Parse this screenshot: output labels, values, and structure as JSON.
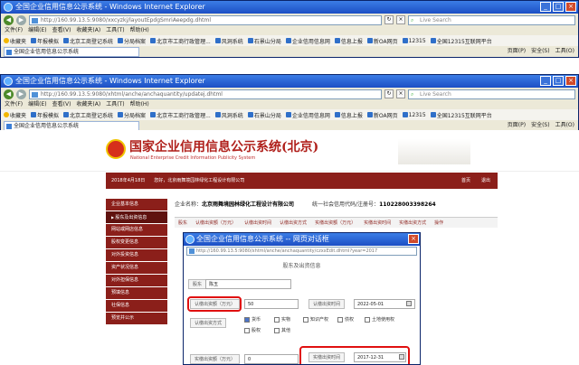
{
  "window1": {
    "title": "全国企业信用信息公示系统 - Windows Internet Explorer",
    "url": "http://160.99.13.5:9080/xxcyzkj/layoutEpdgSmriAeepdg.dhtml",
    "search_placeholder": "Live Search",
    "tab_label": "全国企业信用信息公示系统"
  },
  "window2": {
    "title": "全国企业信用信息公示系统 - Windows Internet Explorer",
    "url": "http://160.99.13.5:9080/xhtml/anche/anchaquantity/updatej.dhtml",
    "search_placeholder": "Live Search",
    "tab_label": "全国企业信用信息公示系统"
  },
  "menu": [
    "文件(F)",
    "编辑(E)",
    "查看(V)",
    "收藏夹(A)",
    "工具(T)",
    "帮助(H)"
  ],
  "favorites": [
    "收藏夹",
    "年报模拟",
    "北京工商登记系统",
    "分局档案",
    "北京市工商行政管理...",
    "风洞系统",
    "石景山分局",
    "企业信用信息网",
    "信息上报",
    "新OA网页",
    "12315",
    "全国12315互联网平台"
  ],
  "tools": [
    "页面(P)",
    "安全(S)",
    "工具(O)"
  ],
  "site": {
    "title": "国家企业信用信息公示系统(北京)",
    "subtitle": "National Enterprise Credit Information Publicity System",
    "date": "2018年4月18日",
    "greeting": "您好，北京雨舞境园林绿化工程设计有限公司",
    "links": [
      "首页",
      "退出"
    ]
  },
  "sidebar": [
    "企业基本信息",
    "股东及出资信息",
    "网站或网店信息",
    "股权变更信息",
    "对外投资信息",
    "资产状况信息",
    "对外担保信息",
    "预填信息",
    "社保信息",
    "预览并公示"
  ],
  "company": {
    "name_label": "企业名称：",
    "name": "北京雨舞境园林绿化工程设计有限公司",
    "code_label": "统一社会信用代码/注册号：",
    "code": "110228003398264"
  },
  "columns": [
    "股东",
    "认缴出资额（万元）",
    "认缴出资时间",
    "认缴出资方式",
    "实缴出资额（万元）",
    "实缴出资时间",
    "实缴出资方式",
    "操作"
  ],
  "dialog": {
    "title": "全国企业信用信息公示系统 -- 网页对话框",
    "url": "http://160.99.13.5:9080/xhtml/anche/anchaquantity/czxxEdit.dhtml?year=2017",
    "heading": "股东及出资信息",
    "shareholder_label": "股东",
    "shareholder_value": "陈玉",
    "sub_amount_label": "认缴出资额（万元）",
    "sub_amount_value": "50",
    "sub_date_label": "认缴出资时间",
    "sub_date_value": "2022-05-01",
    "sub_method_label": "认缴出资方式",
    "methods": [
      "货币",
      "实物",
      "知识产权",
      "债权",
      "土地使用权",
      "股权",
      "其他"
    ],
    "paid_amount_label": "实缴出资额（万元）",
    "paid_amount_value": "0",
    "paid_date_label": "实缴出资时间",
    "paid_date_value": "2017-12-31"
  }
}
